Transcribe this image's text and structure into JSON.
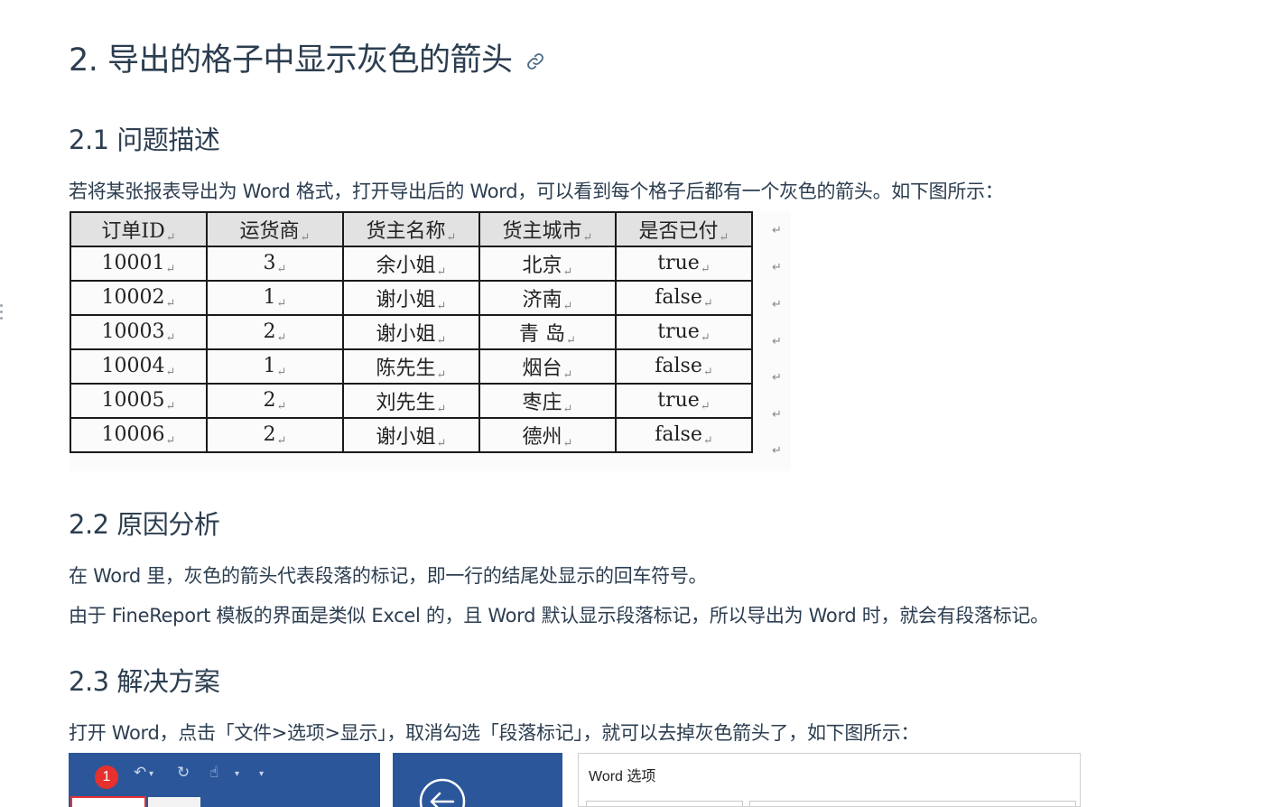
{
  "h1": "2. 导出的格子中显示灰色的箭头",
  "sections": {
    "s1": {
      "title": "2.1 问题描述",
      "text": "若将某张报表导出为 Word 格式，打开导出后的 Word，可以看到每个格子后都有一个灰色的箭头。如下图所示："
    },
    "s2": {
      "title": "2.2 原因分析",
      "text1": "在 Word 里，灰色的箭头代表段落的标记，即一行的结尾处显示的回车符号。",
      "text2": "由于 FineReport 模板的界面是类似 Excel 的，且 Word 默认显示段落标记，所以导出为 Word 时，就会有段落标记。"
    },
    "s3": {
      "title": "2.3 解决方案",
      "text": "打开 Word，点击「文件>选项>显示」，取消勾选「段落标记」，就可以去掉灰色箭头了，如下图所示："
    }
  },
  "para_mark": "↵",
  "table": {
    "headers": [
      "订单ID",
      "运货商",
      "货主名称",
      "货主城市",
      "是否已付"
    ],
    "rows": [
      [
        "10001",
        "3",
        "余小姐",
        "北京",
        "true"
      ],
      [
        "10002",
        "1",
        "谢小姐",
        "济南",
        "false"
      ],
      [
        "10003",
        "2",
        "谢小姐",
        "青 岛",
        "true"
      ],
      [
        "10004",
        "1",
        "陈先生",
        "烟台",
        "false"
      ],
      [
        "10005",
        "2",
        "刘先生",
        "枣庄",
        "true"
      ],
      [
        "10006",
        "2",
        "谢小姐",
        "德州",
        "false"
      ]
    ]
  },
  "screenshot": {
    "badge": "1",
    "dialog_title": "Word 选项"
  },
  "colors": {
    "text": "#2c3e50",
    "word_blue": "#2b579a",
    "badge_red": "#e6312e",
    "header_fill": "#e2e2e2"
  }
}
